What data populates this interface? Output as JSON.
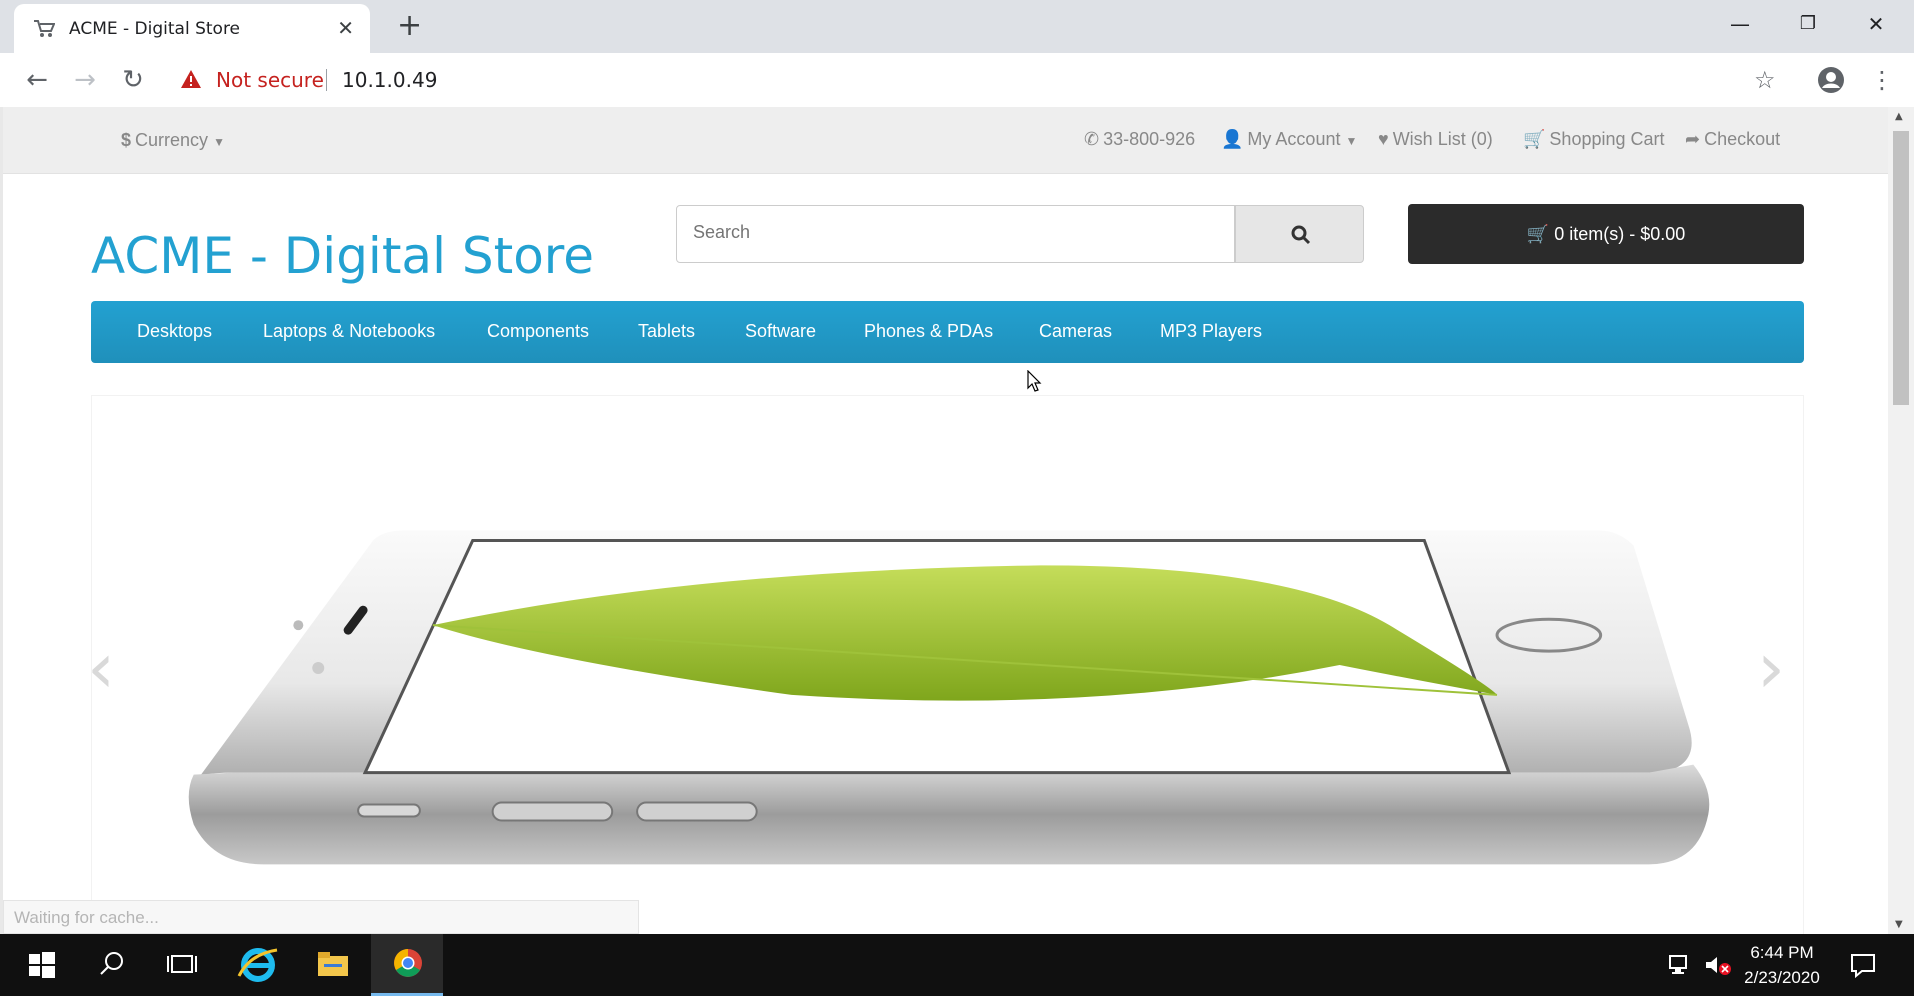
{
  "browser": {
    "tab_title": "ACME - Digital Store",
    "security_label": "Not secure",
    "url": "10.1.0.49",
    "status_text": "Waiting for cache..."
  },
  "topbar": {
    "currency": "Currency",
    "phone": "33-800-926",
    "my_account": "My Account",
    "wishlist": "Wish List (0)",
    "shopping_cart": "Shopping Cart",
    "checkout": "Checkout"
  },
  "header": {
    "logo": "ACME - Digital Store",
    "search_placeholder": "Search",
    "cart_summary": "0 item(s) - $0.00"
  },
  "menu": {
    "items": [
      "Desktops",
      "Laptops & Notebooks",
      "Components",
      "Tablets",
      "Software",
      "Phones & PDAs",
      "Cameras",
      "MP3 Players"
    ]
  },
  "slideshow": {
    "prev": "‹",
    "next": "›"
  },
  "taskbar": {
    "time": "6:44 PM",
    "date": "2/23/2020"
  },
  "colors": {
    "brand": "#23a1d1",
    "menu": "#229ac8",
    "cart_button": "#2b2b2b",
    "warning": "#c5221f"
  },
  "icons": [
    "shopping-cart-icon",
    "close-icon",
    "plus-icon",
    "back-icon",
    "forward-icon",
    "reload-icon",
    "warning-icon",
    "star-icon",
    "profile-icon",
    "menu-dots-icon",
    "phone-icon",
    "user-icon",
    "heart-icon",
    "share-icon",
    "search-icon",
    "chevron-left-icon",
    "chevron-right-icon",
    "windows-icon",
    "chrome-icon"
  ]
}
